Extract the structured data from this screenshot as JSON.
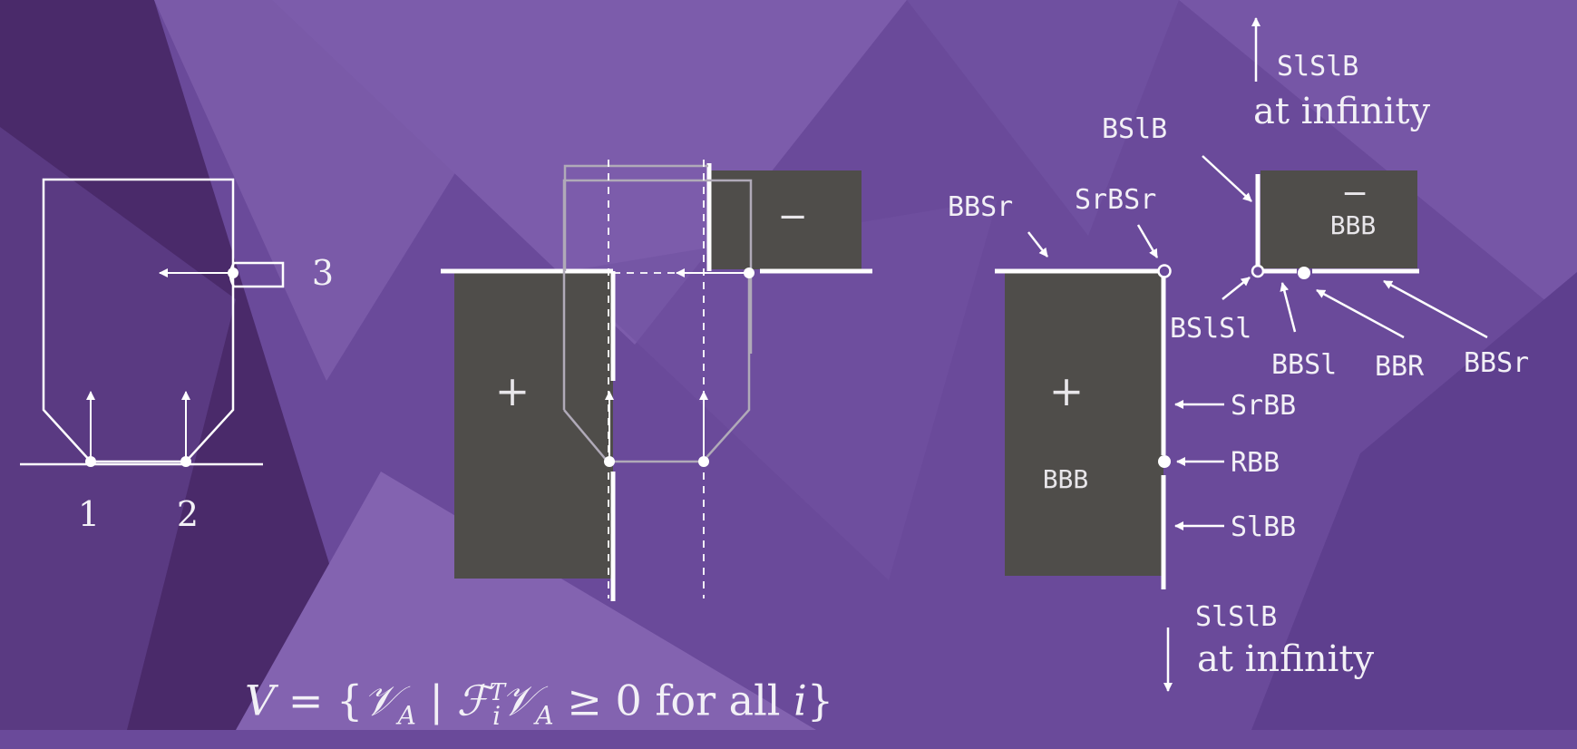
{
  "left_diagram": {
    "contact_labels": [
      "1",
      "2",
      "3"
    ]
  },
  "middle_diagram": {
    "top_block_sign": "−",
    "bottom_block_sign": "+"
  },
  "right_diagram": {
    "top_block_sign": "−",
    "top_block_label": "BBB",
    "bottom_block_sign": "+",
    "bottom_block_label": "BBB",
    "top_arrow_label": "SlSlB",
    "top_arrow_caption": "at infinity",
    "bottom_arrow_label": "SlSlB",
    "bottom_arrow_caption": "at infinity",
    "labels": {
      "bslb": "BSlB",
      "bbsr_left": "BBSr",
      "srbsr": "SrBSr",
      "bsls1": "BSlSl",
      "bbsl": "BBSl",
      "bbr": "BBR",
      "bbsr_right": "BBSr",
      "srbb": "SrBB",
      "rbb": "RBB",
      "slbb": "SlBB"
    }
  },
  "formula": {
    "v": "V",
    "eq": "= {",
    "va": "𝒱",
    "va_sub": "A",
    "bar": "|",
    "f": "ℱ",
    "f_sub": "i",
    "f_sup": "T",
    "va2": "𝒱",
    "va2_sub": "A",
    "geq": "≥ 0",
    "for_all": "for all",
    "i": "i",
    "close": "}"
  },
  "colors": {
    "background": "#6a4a9a",
    "block_fill": "#4f4d4a",
    "line": "#ffffff",
    "gray_line": "#b0aab8",
    "text": "#f2f0f6"
  }
}
